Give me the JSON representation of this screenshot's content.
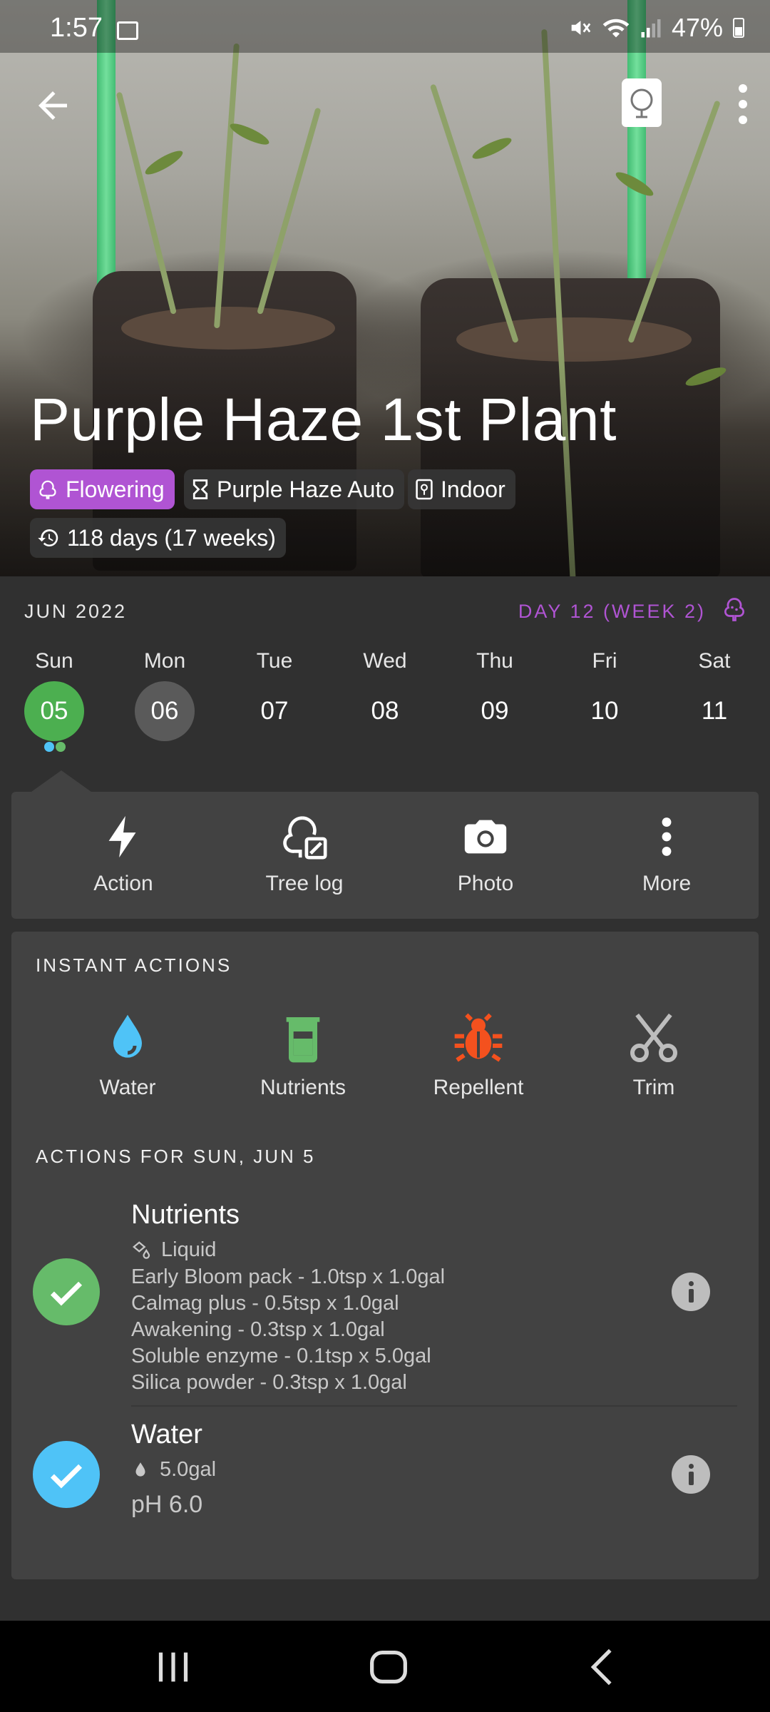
{
  "status_bar": {
    "time": "1:57",
    "battery": "47%"
  },
  "hero": {
    "title": "Purple Haze 1st Plant",
    "chips": {
      "stage": "Flowering",
      "strain": "Purple Haze Auto",
      "environment": "Indoor",
      "age": "118 days (17 weeks)"
    }
  },
  "calendar": {
    "month": "JUN 2022",
    "day_label": "DAY 12 (WEEK 2)",
    "days": [
      {
        "dow": "Sun",
        "num": "05"
      },
      {
        "dow": "Mon",
        "num": "06"
      },
      {
        "dow": "Tue",
        "num": "07"
      },
      {
        "dow": "Wed",
        "num": "08"
      },
      {
        "dow": "Thu",
        "num": "09"
      },
      {
        "dow": "Fri",
        "num": "10"
      },
      {
        "dow": "Sat",
        "num": "11"
      }
    ]
  },
  "action_bar": {
    "action": "Action",
    "tree_log": "Tree log",
    "photo": "Photo",
    "more": "More"
  },
  "instant_actions": {
    "title": "INSTANT ACTIONS",
    "water": "Water",
    "nutrients": "Nutrients",
    "repellent": "Repellent",
    "trim": "Trim"
  },
  "actions_for_day": {
    "title": "ACTIONS FOR SUN, JUN 5",
    "nutrients": {
      "title": "Nutrients",
      "type": "Liquid",
      "lines": [
        "Early Bloom pack  - 1.0tsp x 1.0gal",
        "Calmag plus - 0.5tsp x 1.0gal",
        "Awakening  - 0.3tsp x 1.0gal",
        "Soluble enzyme - 0.1tsp x 5.0gal",
        "Silica powder - 0.3tsp x 1.0gal"
      ]
    },
    "water": {
      "title": "Water",
      "amount": "5.0gal",
      "ph": "pH 6.0"
    }
  },
  "colors": {
    "accent_purple": "#b054d3",
    "green": "#4caf50",
    "water_blue": "#4fc3f7",
    "nutrient_green": "#66bb6a",
    "repellent_orange": "#f4511e"
  }
}
